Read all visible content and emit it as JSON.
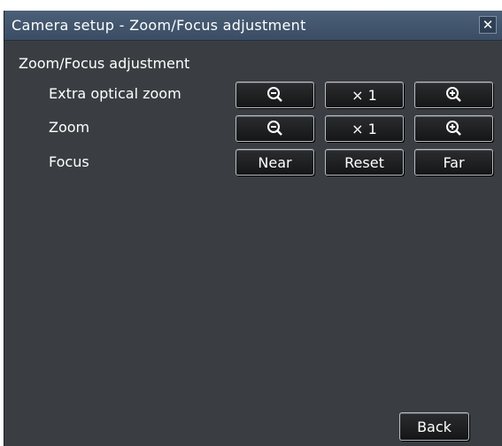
{
  "dialog": {
    "title": "Camera setup - Zoom/Focus adjustment",
    "close_label": "✕"
  },
  "section": {
    "title": "Zoom/Focus adjustment"
  },
  "rows": {
    "extra_optical_zoom": {
      "label": "Extra optical zoom",
      "minus_icon": "zoom-out-icon",
      "reset_label": "× 1",
      "plus_icon": "zoom-in-icon"
    },
    "zoom": {
      "label": "Zoom",
      "minus_icon": "zoom-out-icon",
      "reset_label": "× 1",
      "plus_icon": "zoom-in-icon"
    },
    "focus": {
      "label": "Focus",
      "near_label": "Near",
      "reset_label": "Reset",
      "far_label": "Far"
    }
  },
  "footer": {
    "back_label": "Back"
  }
}
